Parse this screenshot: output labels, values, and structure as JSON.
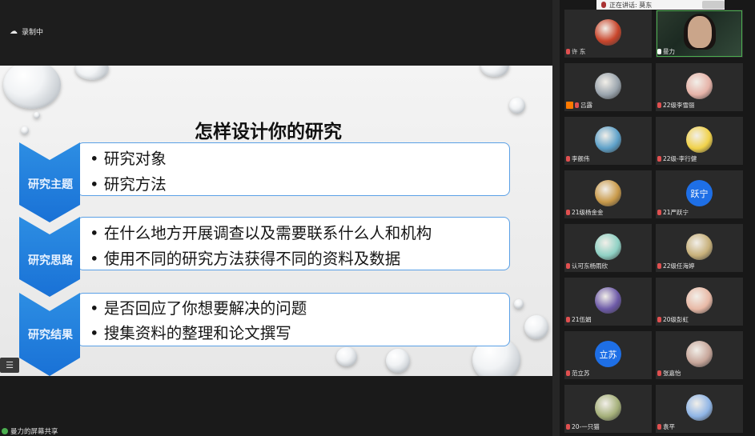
{
  "topbar": {
    "recording_label": "录制中",
    "speaker_label": "正在讲话: 莫东"
  },
  "slide": {
    "title": "怎样设计你的研究",
    "sections": [
      {
        "label": "研究主题",
        "items": [
          "• 研究对象",
          "• 研究方法"
        ]
      },
      {
        "label": "研究思路",
        "items": [
          "• 在什么地方开展调查以及需要联系什么人和机构",
          "• 使用不同的研究方法获得不同的资料及数据"
        ]
      },
      {
        "label": "研究结果",
        "items": [
          "• 是否回应了你想要解决的问题",
          "• 搜集资料的整理和论文撰写"
        ]
      }
    ]
  },
  "bottom": {
    "share_label": "曼力的屏幕共享",
    "list_icon": "list-icon"
  },
  "participants": [
    {
      "name": "许  东",
      "avatar_text": "",
      "color": "#c9452b",
      "mic": "muted"
    },
    {
      "name": "曼力",
      "avatar_text": "",
      "color": "#3b4a3e",
      "mic": "on",
      "video": true
    },
    {
      "name": "吕露",
      "avatar_text": "",
      "color": "#9aa4ad",
      "mic": "muted",
      "hand": true
    },
    {
      "name": "22级李雪丽",
      "avatar_text": "",
      "color": "#e6b3a8",
      "mic": "muted"
    },
    {
      "name": "李舰伟",
      "avatar_text": "",
      "color": "#5ea1c9",
      "mic": "muted"
    },
    {
      "name": "22级-李行健",
      "avatar_text": "",
      "color": "#f1d24a",
      "mic": "muted"
    },
    {
      "name": "21级杨金金",
      "avatar_text": "",
      "color": "#c99a4a",
      "mic": "muted"
    },
    {
      "name": "21严跃宁",
      "avatar_text": "跃宁",
      "color": "#1e6fe6",
      "mic": "muted"
    },
    {
      "name": "认可东杨雨欣",
      "avatar_text": "",
      "color": "#8fd1c4",
      "mic": "muted"
    },
    {
      "name": "22级任海婷",
      "avatar_text": "",
      "color": "#c7b07a",
      "mic": "muted"
    },
    {
      "name": "21伍娟",
      "avatar_text": "",
      "color": "#6d5aa8",
      "mic": "muted"
    },
    {
      "name": "20级彭虹",
      "avatar_text": "",
      "color": "#e8b9a6",
      "mic": "muted"
    },
    {
      "name": "范立苏",
      "avatar_text": "立苏",
      "color": "#1e6fe6",
      "mic": "muted"
    },
    {
      "name": "张嘉怡",
      "avatar_text": "",
      "color": "#c7a69a",
      "mic": "muted"
    },
    {
      "name": "20-一只猫",
      "avatar_text": "",
      "color": "#a5b07a",
      "mic": "muted"
    },
    {
      "name": "袁平",
      "avatar_text": "",
      "color": "#8fb5e6",
      "mic": "muted"
    }
  ]
}
